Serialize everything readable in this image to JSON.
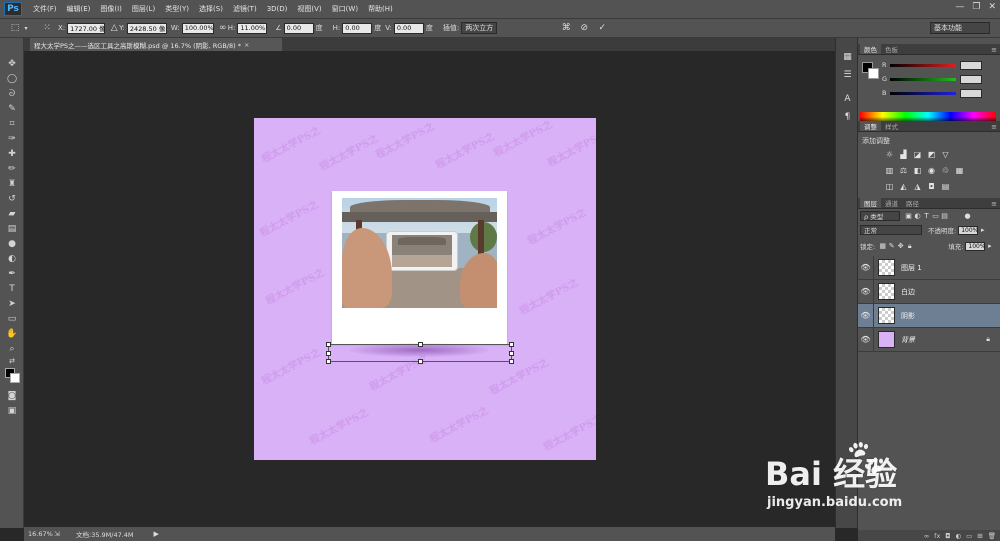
{
  "app": {
    "logo": "Ps",
    "menu": [
      "文件(F)",
      "编辑(E)",
      "图像(I)",
      "图层(L)",
      "类型(Y)",
      "选择(S)",
      "滤镜(T)",
      "3D(D)",
      "视图(V)",
      "窗口(W)",
      "帮助(H)"
    ],
    "window_controls": [
      "—",
      "❐",
      "✕"
    ]
  },
  "options": {
    "x_label": "X:",
    "x_value": "1727.00 像",
    "y_label": "Y:",
    "y_value": "2428.50 像",
    "w_label": "W:",
    "w_value": "100.00%",
    "h_label": "H:",
    "h_value": "11.00%",
    "angle_value": "0.00",
    "angle_unit": "度",
    "hskew_label": "H:",
    "hskew_value": "0.00",
    "vskew_label": "V:",
    "vskew_value": "0.00",
    "interp_label": "插值:",
    "interp_value": "两次立方",
    "workspace": "基本功能"
  },
  "document": {
    "tab_title": "程大太学PS之——选区工具之高斯模糊.psd @ 16.7% (阴影, RGB/8) *",
    "tab_close": "×",
    "watermark": "程太太学PS之"
  },
  "color_panel": {
    "tabs": [
      "颜色",
      "色板"
    ],
    "labels": [
      "R",
      "G",
      "B"
    ],
    "colors": [
      "#e02020",
      "#20c020",
      "#2020e0"
    ]
  },
  "adjust_panel": {
    "tabs": [
      "调整",
      "样式"
    ],
    "title": "添加调整"
  },
  "layers_panel": {
    "tabs": [
      "图层",
      "通道",
      "路径"
    ],
    "filter_kind": "ρ 类型",
    "blend_mode": "正常",
    "opacity_label": "不透明度:",
    "opacity_value": "100%",
    "lock_label": "锁定:",
    "fill_label": "填充:",
    "fill_value": "100%",
    "layers": [
      {
        "name": "图层 1",
        "visible": true,
        "selected": false
      },
      {
        "name": "白边",
        "visible": true,
        "selected": false
      },
      {
        "name": "阴影",
        "visible": true,
        "selected": true
      },
      {
        "name": "背景",
        "visible": true,
        "selected": false,
        "locked": true
      }
    ]
  },
  "status": {
    "zoom": "16.67%",
    "doc_size": "文档:35.9M/47.4M"
  },
  "baidu": {
    "text": "Bai  经验",
    "url": "jingyan.baidu.com"
  }
}
